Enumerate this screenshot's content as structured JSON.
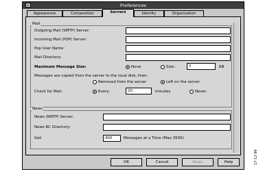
{
  "window": {
    "title": "Preferences"
  },
  "tabs": [
    {
      "label": "Appearance",
      "active": false
    },
    {
      "label": "Composition",
      "active": false
    },
    {
      "label": "Servers",
      "active": true
    },
    {
      "label": "Identity",
      "active": false
    },
    {
      "label": "Organization",
      "active": false
    }
  ],
  "mail": {
    "group_label": "Mail",
    "outgoing_label": "Outgoing Mail (SMTP) Server:",
    "outgoing_value": "",
    "incoming_label": "Incoming Mail (POP) Server:",
    "incoming_value": "",
    "pop_user_label": "Pop User Name:",
    "pop_user_value": "",
    "directory_label": "Mail Directory:",
    "directory_value": "",
    "max_size_label": "Maximum Message Size:",
    "max_none_label": "None",
    "max_size_opt_label": "Size:",
    "max_size_value": "0",
    "max_size_unit": "KB",
    "copied_text": "Messages are copied from the server to the local disk, then:",
    "removed_label": "Removed from the server",
    "left_label": "Left on the server",
    "check_label": "Check for Mail:",
    "every_label": "Every:",
    "every_value": "20",
    "minutes_label": "minutes",
    "never_label": "Never"
  },
  "news": {
    "group_label": "News",
    "server_label": "News (NNTP) Server:",
    "server_value": "",
    "rc_label": "News RC Directory:",
    "rc_value": "",
    "get_label": "Get:",
    "get_value": "400",
    "messages_label": "Messages at a Time (Max 3500)"
  },
  "buttons": {
    "ok": "OK",
    "cancel": "Cancel",
    "apply": "Apply",
    "help": "Help"
  },
  "side_code": "17-12-99"
}
